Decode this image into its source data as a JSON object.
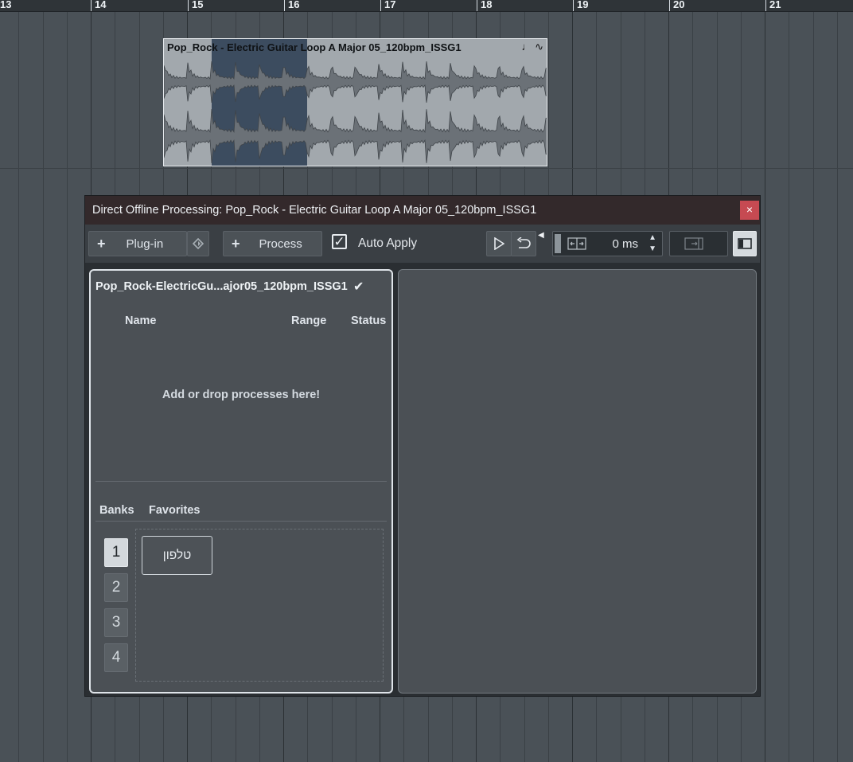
{
  "ruler": {
    "marks": [
      "13",
      "14",
      "15",
      "16",
      "17",
      "18",
      "19",
      "20",
      "21"
    ]
  },
  "event": {
    "title": "Pop_Rock - Electric Guitar Loop A Major 05_120bpm_ISSG1",
    "icons": [
      "note-icon",
      "waveform-icon"
    ]
  },
  "dialog": {
    "title": "Direct Offline Processing: Pop_Rock - Electric Guitar Loop A Major 05_120bpm_ISSG1",
    "close_glyph": "×",
    "toolbar": {
      "plugin_label": "Plug-in",
      "process_label": "Process",
      "auto_apply_label": "Auto Apply",
      "auto_apply_checked": true,
      "preroll_value": "0 ms"
    },
    "left": {
      "clip_name": "Pop_Rock-ElectricGu...ajor05_120bpm_ISSG1",
      "columns": {
        "name": "Name",
        "range": "Range",
        "status": "Status"
      },
      "drop_hint": "Add or drop processes here!",
      "banks_label": "Banks",
      "favorites_label": "Favorites",
      "banks": [
        "1",
        "2",
        "3",
        "4"
      ],
      "active_bank": "1",
      "favorite_slot": "טלפון"
    }
  },
  "colors": {
    "accent_close": "#c64a52",
    "panel_border_active": "#dfe4e9",
    "event_select": "#1d3450"
  }
}
